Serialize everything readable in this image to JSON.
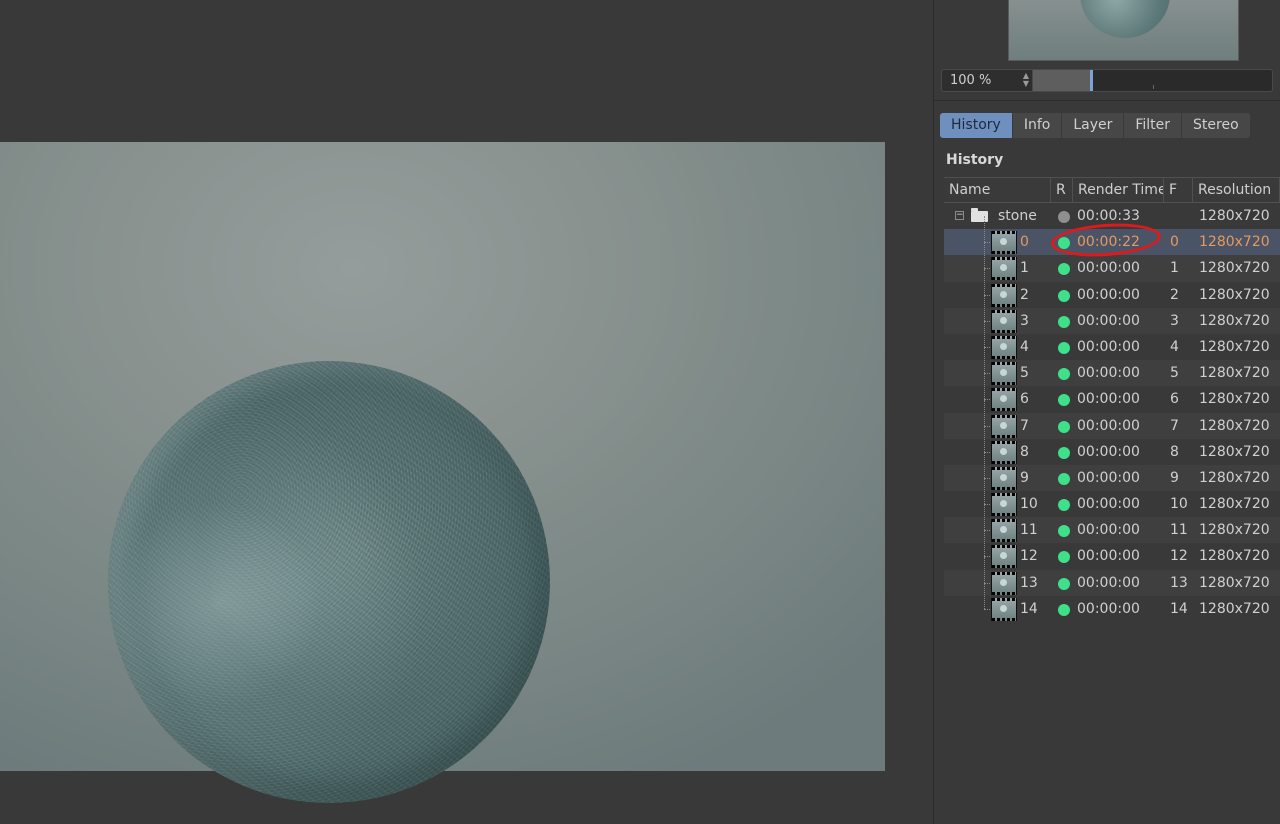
{
  "zoom": {
    "value": "100 %",
    "level_percent": 100
  },
  "tabs": [
    {
      "label": "History",
      "active": true
    },
    {
      "label": "Info",
      "active": false
    },
    {
      "label": "Layer",
      "active": false
    },
    {
      "label": "Filter",
      "active": false
    },
    {
      "label": "Stereo",
      "active": false
    }
  ],
  "history": {
    "heading": "History",
    "columns": {
      "name": "Name",
      "r": "R",
      "render_time": "Render Time",
      "f": "F",
      "resolution": "Resolution"
    },
    "folder": {
      "name": "stone",
      "render_time": "00:00:33",
      "frame": "",
      "resolution": "1280x720",
      "status": "gray"
    },
    "rows": [
      {
        "name": "0",
        "render_time": "00:00:22",
        "frame": "0",
        "resolution": "1280x720",
        "selected": true
      },
      {
        "name": "1",
        "render_time": "00:00:00",
        "frame": "1",
        "resolution": "1280x720"
      },
      {
        "name": "2",
        "render_time": "00:00:00",
        "frame": "2",
        "resolution": "1280x720"
      },
      {
        "name": "3",
        "render_time": "00:00:00",
        "frame": "3",
        "resolution": "1280x720"
      },
      {
        "name": "4",
        "render_time": "00:00:00",
        "frame": "4",
        "resolution": "1280x720"
      },
      {
        "name": "5",
        "render_time": "00:00:00",
        "frame": "5",
        "resolution": "1280x720"
      },
      {
        "name": "6",
        "render_time": "00:00:00",
        "frame": "6",
        "resolution": "1280x720"
      },
      {
        "name": "7",
        "render_time": "00:00:00",
        "frame": "7",
        "resolution": "1280x720"
      },
      {
        "name": "8",
        "render_time": "00:00:00",
        "frame": "8",
        "resolution": "1280x720"
      },
      {
        "name": "9",
        "render_time": "00:00:00",
        "frame": "9",
        "resolution": "1280x720"
      },
      {
        "name": "10",
        "render_time": "00:00:00",
        "frame": "10",
        "resolution": "1280x720"
      },
      {
        "name": "11",
        "render_time": "00:00:00",
        "frame": "11",
        "resolution": "1280x720"
      },
      {
        "name": "12",
        "render_time": "00:00:00",
        "frame": "12",
        "resolution": "1280x720"
      },
      {
        "name": "13",
        "render_time": "00:00:00",
        "frame": "13",
        "resolution": "1280x720"
      },
      {
        "name": "14",
        "render_time": "00:00:00",
        "frame": "14",
        "resolution": "1280x720"
      }
    ]
  },
  "colors": {
    "accent_tab": "#6f8fbf",
    "status_green": "#3ee08a",
    "selected_text": "#e39a5e",
    "annotation": "#e01a1a"
  }
}
